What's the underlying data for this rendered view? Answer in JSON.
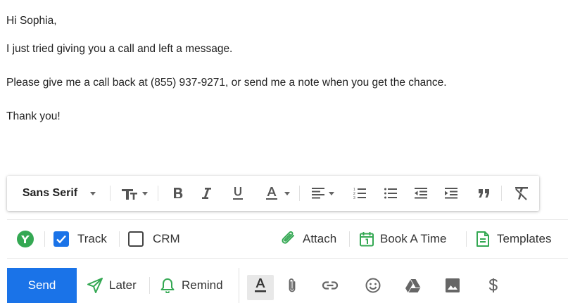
{
  "message": {
    "greeting": "Hi Sophia,",
    "line1": "I just tried giving you a call and left a message.",
    "line2": "Please give me a call back at (855) 937-9271, or send me a note when you get the chance.",
    "closing": "Thank you!"
  },
  "format_toolbar": {
    "font_family": "Sans Serif",
    "icons": [
      "font-size-icon",
      "bold-icon",
      "italic-icon",
      "underline-icon",
      "text-color-icon",
      "align-icon",
      "numbered-list-icon",
      "bulleted-list-icon",
      "indent-less-icon",
      "indent-more-icon",
      "quote-icon",
      "remove-formatting-icon"
    ]
  },
  "tracking_bar": {
    "track_label": "Track",
    "track_checked": true,
    "crm_label": "CRM",
    "crm_checked": false,
    "attach_label": "Attach",
    "book_label": "Book A Time",
    "templates_label": "Templates",
    "colors": {
      "green": "#34a853",
      "checkbox_blue": "#1a73e8"
    }
  },
  "send_bar": {
    "send_label": "Send",
    "later_label": "Later",
    "remind_label": "Remind",
    "colors": {
      "send_bg": "#1a73e8",
      "accent": "#34a853"
    },
    "icons": [
      "text-color-icon",
      "attach-icon",
      "link-icon",
      "emoji-icon",
      "drive-icon",
      "photo-icon",
      "dollar-icon"
    ]
  }
}
